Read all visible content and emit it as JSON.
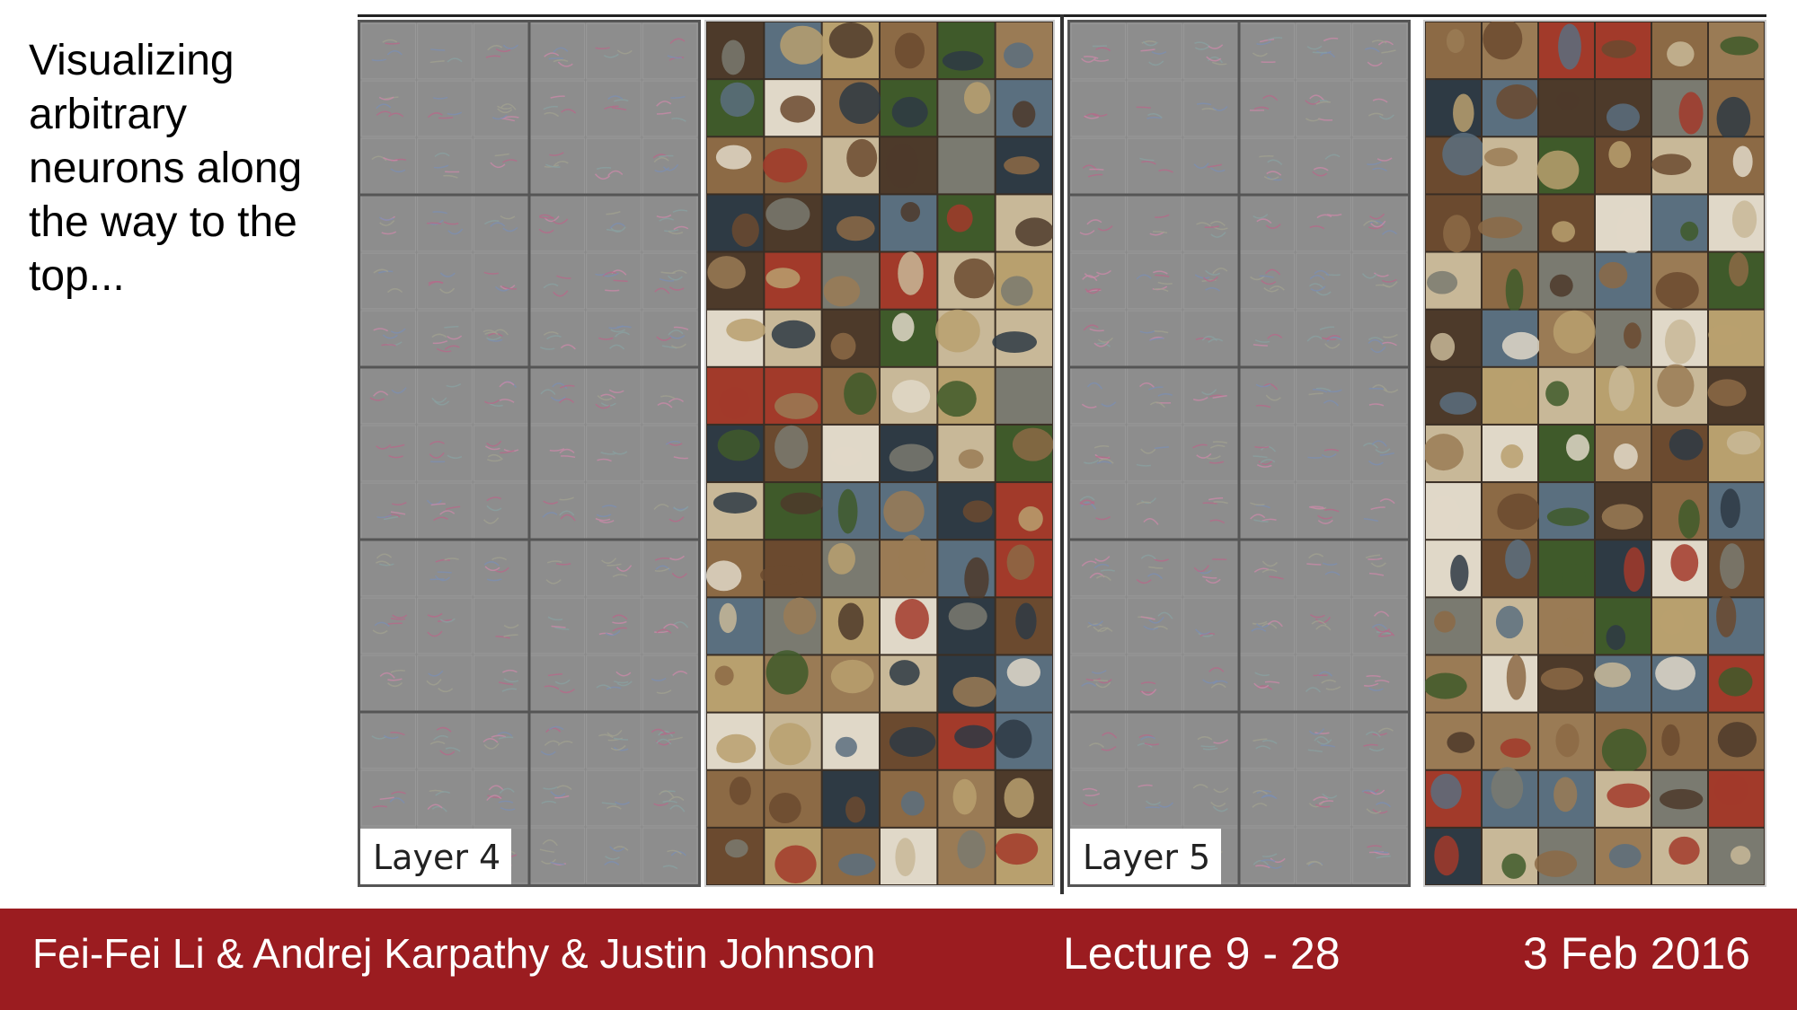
{
  "slide": {
    "title_lines": [
      "Visualizing",
      "arbitrary",
      "neurons along",
      "the way to the",
      "top..."
    ]
  },
  "figure": {
    "layer4_label": "Layer 4",
    "layer5_label": "Layer 5",
    "grid_rows": 15,
    "grid_cols": 6,
    "block_rows": 3,
    "block_cols": 3
  },
  "footer": {
    "authors": "Fei-Fei Li & Andrej Karpathy & Justin Johnson",
    "lecture": "Lecture 9 - 28",
    "date": "3 Feb 2016"
  },
  "colors": {
    "footer_bg": "#9b1c20",
    "grid_bg": "#888888"
  }
}
